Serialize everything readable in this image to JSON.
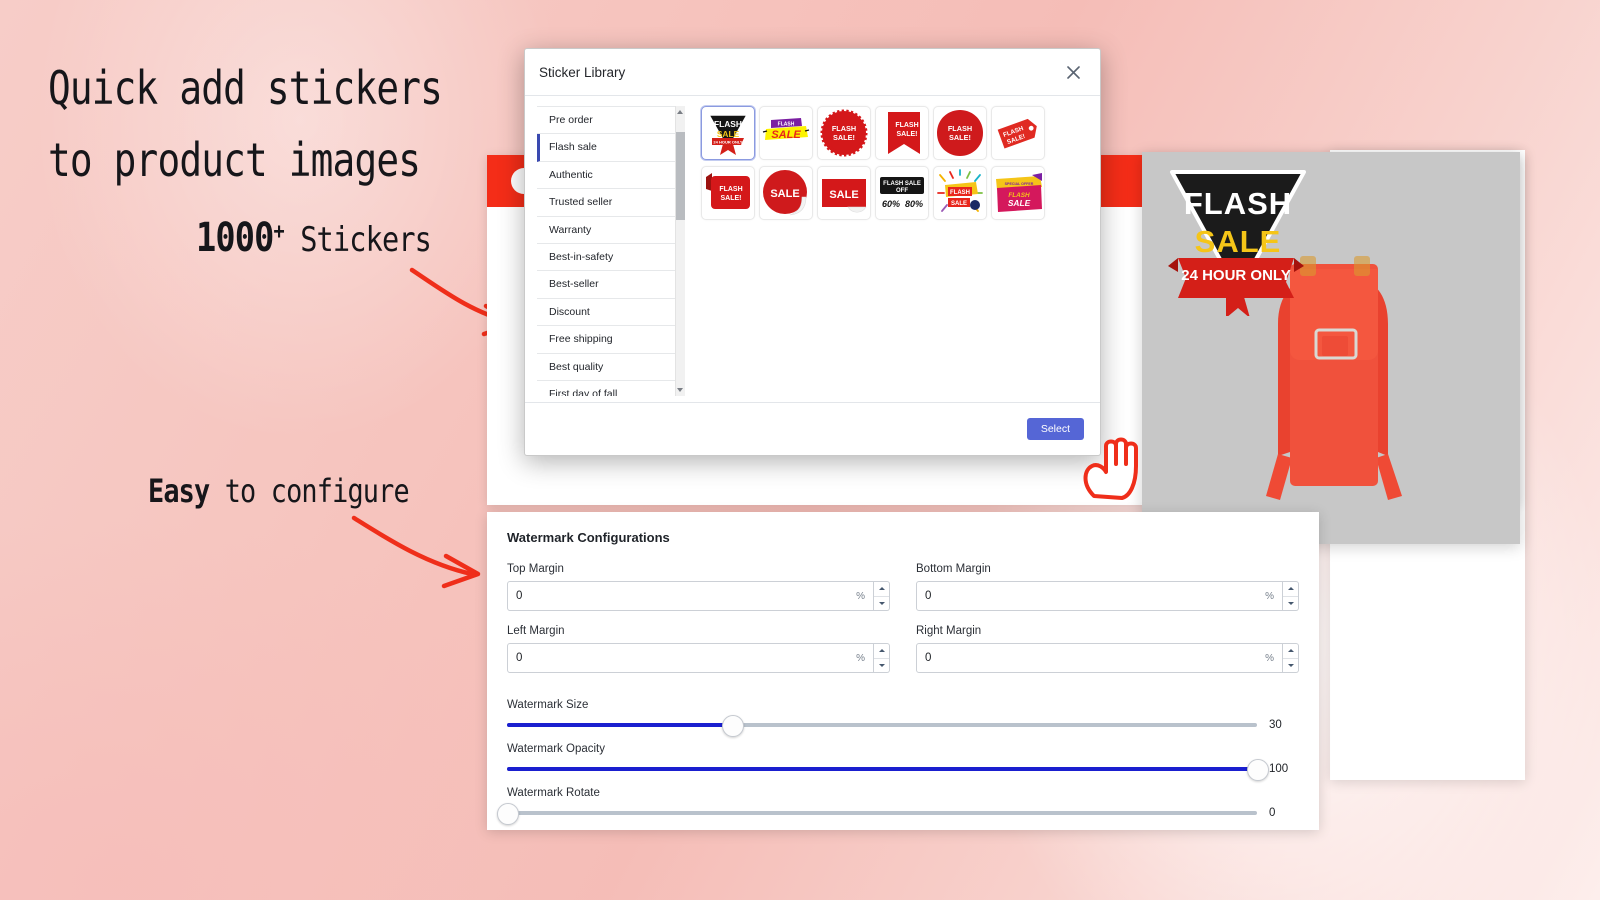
{
  "promo": {
    "headline": "Quick add stickers\nto product images",
    "count_big": "1000",
    "count_sup": "+",
    "count_word": " Stickers",
    "easy_bold": "Easy",
    "easy_rest": " to configure"
  },
  "dialog": {
    "title": "Sticker Library",
    "close_icon": "close-icon",
    "select_label": "Select",
    "categories": [
      {
        "label": "Pre order",
        "active": false
      },
      {
        "label": "Flash sale",
        "active": true
      },
      {
        "label": "Authentic",
        "active": false
      },
      {
        "label": "Trusted seller",
        "active": false
      },
      {
        "label": "Warranty",
        "active": false
      },
      {
        "label": "Best-in-safety",
        "active": false
      },
      {
        "label": "Best-seller",
        "active": false
      },
      {
        "label": "Discount",
        "active": false
      },
      {
        "label": "Free shipping",
        "active": false
      },
      {
        "label": "Best quality",
        "active": false
      },
      {
        "label": "First day of fall",
        "active": false
      }
    ],
    "stickers": [
      {
        "name": "flash-sale-triangle-black",
        "text": "FLASH SALE",
        "sub": "24 HOUR ONLY",
        "selected": true
      },
      {
        "name": "flash-sale-yellow-burst",
        "text": "SALE",
        "sub": "FLASH",
        "selected": false
      },
      {
        "name": "flash-sale-red-seal",
        "text": "FLASH SALE!",
        "sub": "",
        "selected": false
      },
      {
        "name": "flash-sale-red-ribbon",
        "text": "FLASH SALE!",
        "sub": "",
        "selected": false
      },
      {
        "name": "flash-sale-red-wax-stamp",
        "text": "FLASH SALE!",
        "sub": "",
        "selected": false
      },
      {
        "name": "flash-sale-red-tag",
        "text": "FLASH SALE!",
        "sub": "",
        "selected": false
      },
      {
        "name": "flash-sale-red-banner",
        "text": "FLASH SALE!",
        "sub": "",
        "selected": false
      },
      {
        "name": "sale-red-circle-curl",
        "text": "SALE",
        "sub": "",
        "selected": false
      },
      {
        "name": "sale-red-square-curl",
        "text": "SALE",
        "sub": "",
        "selected": false
      },
      {
        "name": "flash-sale-off-black-60-80",
        "text": "FLASH SALE OFF",
        "sub": "60% 80%",
        "selected": false
      },
      {
        "name": "flash-sale-confetti",
        "text": "FLASH SALE",
        "sub": "",
        "selected": false
      },
      {
        "name": "flash-sale-purple-ribbon",
        "text": "FLASH SALE",
        "sub": "SPECIAL OFFER",
        "selected": false
      }
    ]
  },
  "watermark": {
    "title": "Watermark Configurations",
    "unit": "%",
    "fields": [
      {
        "label": "Top Margin",
        "value": "0"
      },
      {
        "label": "Bottom Margin",
        "value": "0"
      },
      {
        "label": "Left Margin",
        "value": "0"
      },
      {
        "label": "Right Margin",
        "value": "0"
      }
    ],
    "sliders": [
      {
        "label": "Watermark Size",
        "value": "30",
        "percent": 30
      },
      {
        "label": "Watermark Opacity",
        "value": "100",
        "percent": 100
      },
      {
        "label": "Watermark Rotate",
        "value": "0",
        "percent": 0
      }
    ]
  },
  "preview": {
    "badge_line1": "FLASH",
    "badge_line2": "SALE",
    "badge_ribbon": "24 HOUR ONLY",
    "product": "red-crossbody-phone-bag"
  },
  "colors": {
    "accent_red": "#f42d18",
    "button_blue": "#5566d6",
    "slider_blue": "#1a1fcf",
    "active_border": "#3a49b0",
    "background_pink": "#f6c5bf"
  }
}
